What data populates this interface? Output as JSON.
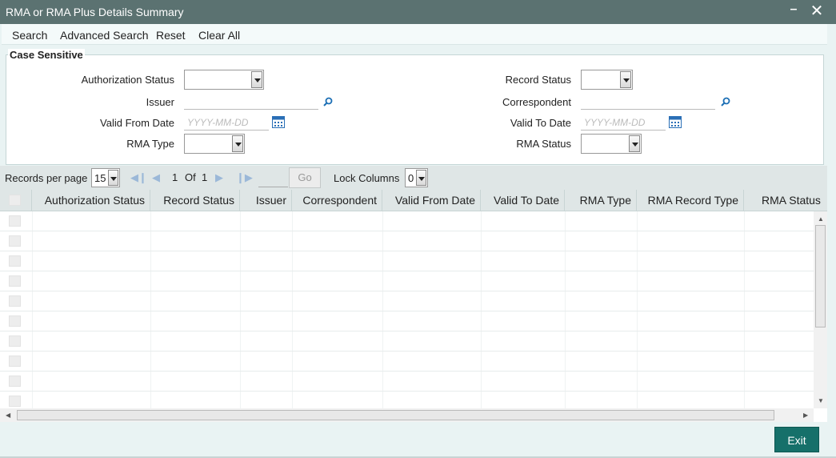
{
  "window": {
    "title": "RMA or RMA Plus Details Summary"
  },
  "menu": {
    "search": "Search",
    "advanced_search": "Advanced Search",
    "reset": "Reset",
    "clear_all": "Clear All"
  },
  "criteria": {
    "legend": "Case Sensitive",
    "authorization_status": {
      "label": "Authorization Status",
      "value": ""
    },
    "record_status": {
      "label": "Record Status",
      "value": ""
    },
    "issuer": {
      "label": "Issuer",
      "value": ""
    },
    "correspondent": {
      "label": "Correspondent",
      "value": ""
    },
    "valid_from_date": {
      "label": "Valid From Date",
      "placeholder": "YYYY-MM-DD"
    },
    "valid_to_date": {
      "label": "Valid To Date",
      "placeholder": "YYYY-MM-DD"
    },
    "rma_type": {
      "label": "RMA Type",
      "value": ""
    },
    "rma_status": {
      "label": "RMA Status",
      "value": ""
    }
  },
  "pager": {
    "records_per_page_label": "Records per page",
    "records_per_page": "15",
    "current_page": "1",
    "of_label": "Of",
    "total_pages": "1",
    "go_label": "Go",
    "lock_columns_label": "Lock Columns",
    "lock_columns": "0"
  },
  "grid": {
    "columns": [
      "Authorization Status",
      "Record Status",
      "Issuer",
      "Correspondent",
      "Valid From Date",
      "Valid To Date",
      "RMA Type",
      "RMA Record Type",
      "RMA Status"
    ],
    "row_count": 10
  },
  "footer": {
    "exit_label": "Exit"
  },
  "icons": {
    "search": "magnifier-icon",
    "calendar": "calendar-icon"
  },
  "colors": {
    "titlebar": "#5b7271",
    "exit_button": "#16706a",
    "background": "#e9f3f3"
  }
}
